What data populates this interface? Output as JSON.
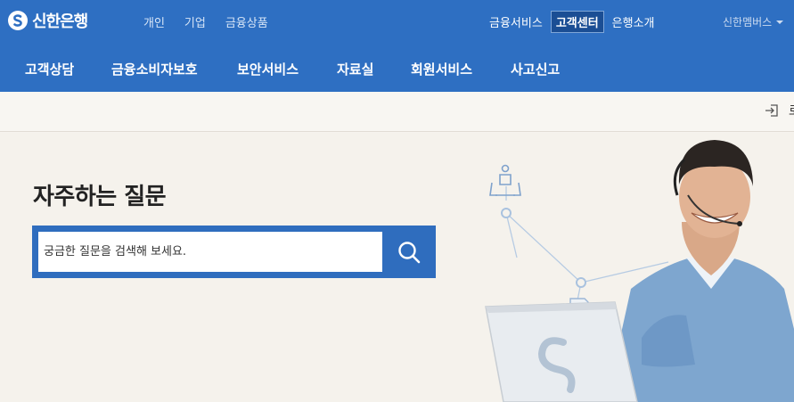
{
  "header": {
    "logo_text": "신한은행",
    "top_left_nav": [
      "개인",
      "기업",
      "금융상품"
    ],
    "top_right_nav": [
      {
        "label": "금융서비스",
        "active": false
      },
      {
        "label": "고객센터",
        "active": true
      },
      {
        "label": "은행소개",
        "active": false
      }
    ],
    "member_menu": "신한멤버스"
  },
  "main_nav": [
    "고객상담",
    "금융소비자보호",
    "보안서비스",
    "자료실",
    "회원서비스",
    "사고신고"
  ],
  "subbar": {
    "login_text": "로"
  },
  "faq": {
    "title": "자주하는 질문",
    "search_placeholder": "궁금한 질문을 검색해 보세요."
  },
  "colors": {
    "brand_blue": "#2e6fc2",
    "hero_bg": "#f5f2ec"
  }
}
